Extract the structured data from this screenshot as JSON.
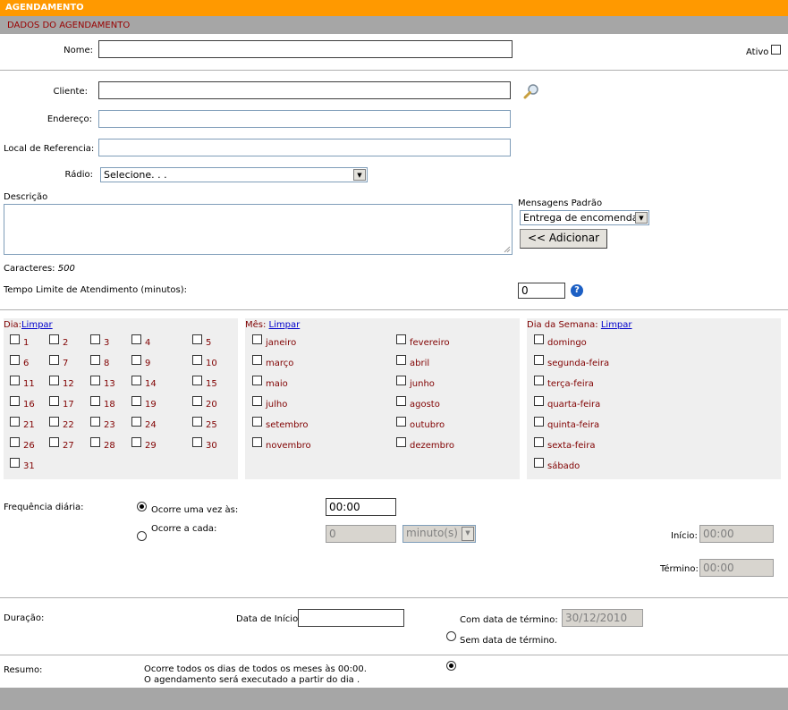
{
  "header": {
    "title": "AGENDAMENTO",
    "subtitle": "DADOS DO AGENDAMENTO"
  },
  "form": {
    "nome_label": "Nome:",
    "ativo_label": "Ativo",
    "cliente_label": "Cliente:",
    "endereco_label": "Endereço:",
    "local_label": "Local de Referencia:",
    "radio_label": "Rádio:",
    "radio_value": "Selecione. . .",
    "descricao_label": "Descrição",
    "mensagens_label": "Mensagens Padrão",
    "mensagens_value": "Entrega de encomenda",
    "adicionar_label": "<< Adicionar",
    "caracteres_label": "Caracteres:",
    "caracteres_value": "500",
    "tempo_label": "Tempo Limite de Atendimento (minutos):",
    "tempo_value": "0"
  },
  "dia": {
    "label": "Dia:",
    "limpar": "Limpar",
    "days": [
      "1",
      "2",
      "3",
      "4",
      "5",
      "6",
      "7",
      "8",
      "9",
      "10",
      "11",
      "12",
      "13",
      "14",
      "15",
      "16",
      "17",
      "18",
      "19",
      "20",
      "21",
      "22",
      "23",
      "24",
      "25",
      "26",
      "27",
      "28",
      "29",
      "30",
      "31"
    ]
  },
  "mes": {
    "label": "Mês:",
    "limpar": "Limpar",
    "months": [
      "janeiro",
      "fevereiro",
      "março",
      "abril",
      "maio",
      "junho",
      "julho",
      "agosto",
      "setembro",
      "outubro",
      "novembro",
      "dezembro"
    ]
  },
  "semana": {
    "label": "Dia da Semana:",
    "limpar": "Limpar",
    "days": [
      "domingo",
      "segunda-feira",
      "terça-feira",
      "quarta-feira",
      "quinta-feira",
      "sexta-feira",
      "sábado"
    ]
  },
  "frequencia": {
    "label": "Frequência diária:",
    "once_label": "Ocorre uma vez às:",
    "once_value": "00:00",
    "every_label": "Ocorre a cada:",
    "every_value": "0",
    "unit_value": "minuto(s)",
    "inicio_label": "Início:",
    "inicio_value": "00:00",
    "termino_label": "Término:",
    "termino_value": "00:00"
  },
  "duracao": {
    "label": "Duração:",
    "data_inicio_label": "Data de Início:",
    "com_termino_label": "Com data de término:",
    "com_termino_value": "30/12/2010",
    "sem_termino_label": "Sem data de término."
  },
  "resumo": {
    "label": "Resumo:",
    "line1": "Ocorre todos os dias de todos os meses às 00:00.",
    "line2": "O agendamento será executado a partir do dia ."
  }
}
